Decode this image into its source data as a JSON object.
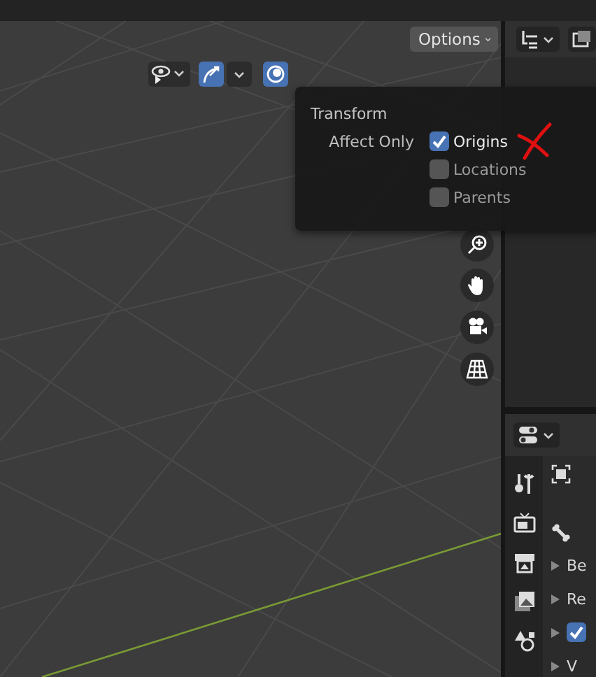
{
  "viewport": {
    "options_button": {
      "label": "Options"
    },
    "popover": {
      "title": "Transform",
      "field_label": "Affect Only",
      "options": [
        {
          "label": "Origins",
          "checked": true
        },
        {
          "label": "Locations",
          "checked": false
        },
        {
          "label": "Parents",
          "checked": false
        }
      ]
    }
  },
  "properties": {
    "rows": [
      {
        "kind": "text",
        "label": "Be"
      },
      {
        "kind": "text",
        "label": "Re"
      },
      {
        "kind": "checkbox",
        "checked": true
      },
      {
        "kind": "text",
        "label": "V"
      }
    ]
  }
}
